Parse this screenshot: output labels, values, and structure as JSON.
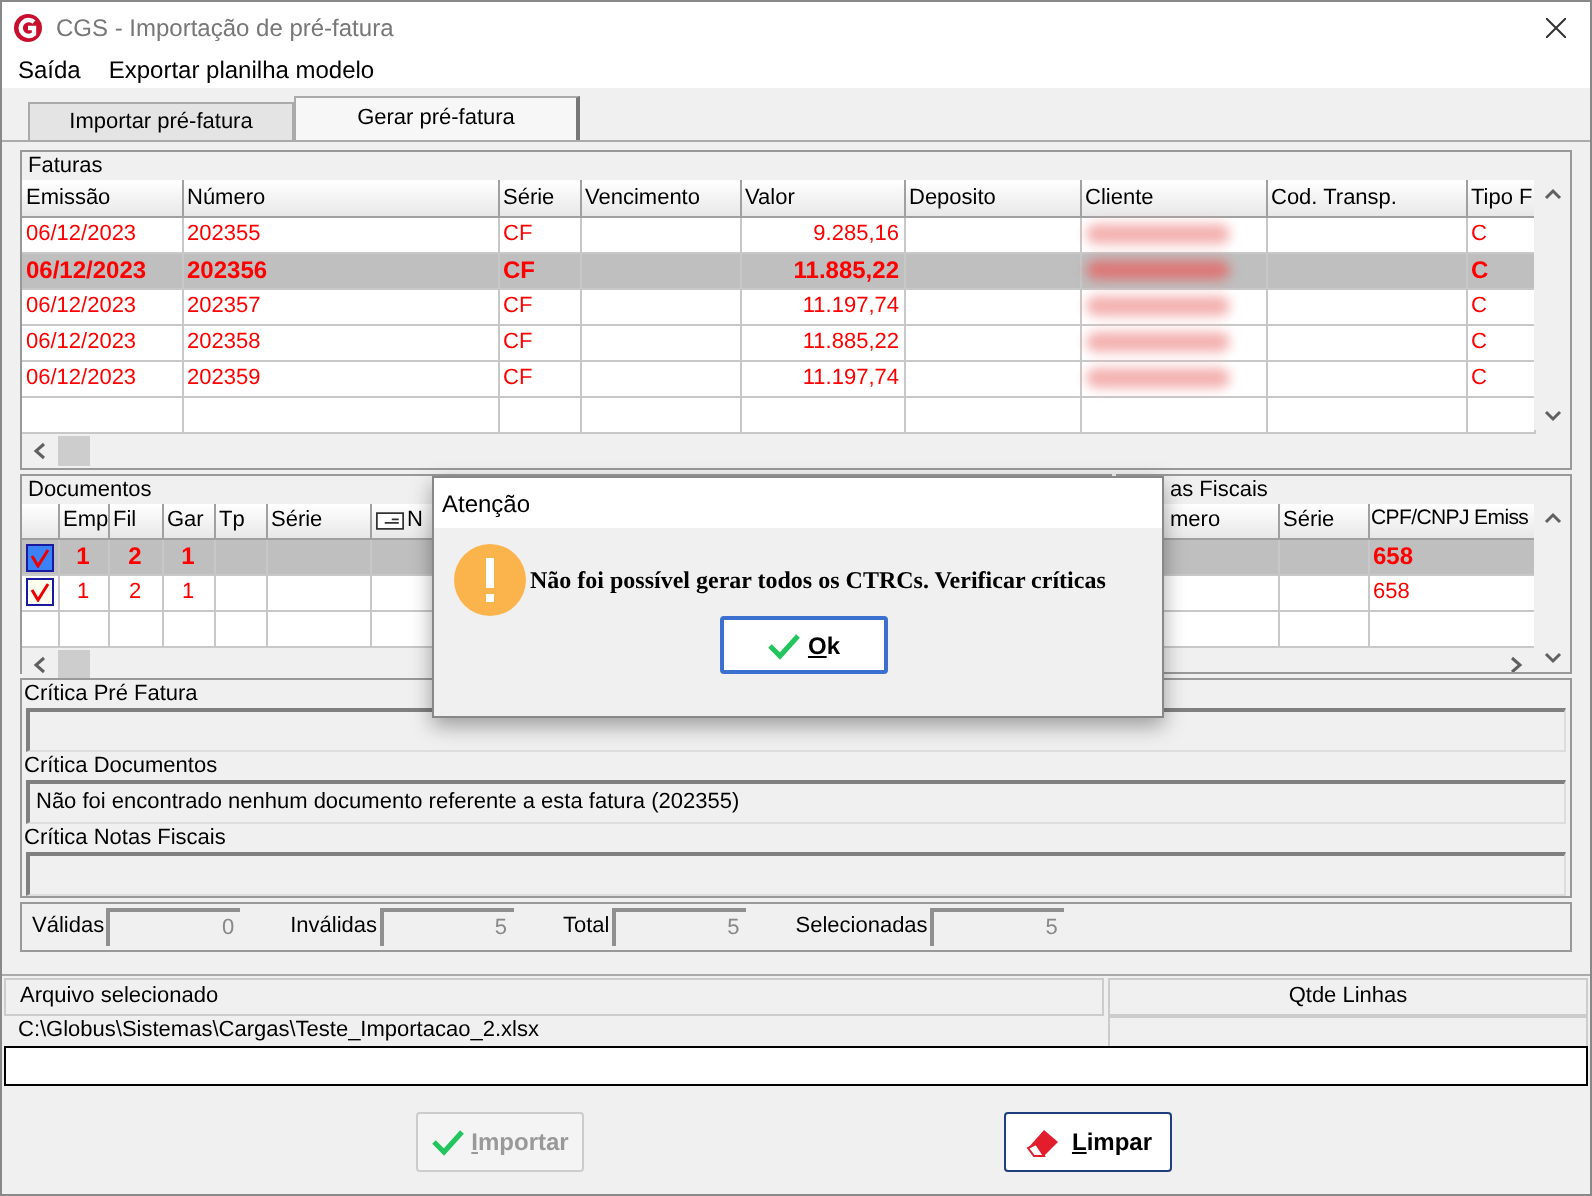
{
  "window": {
    "title": "CGS - Importação de pré-fatura"
  },
  "menu": [
    "Saída",
    "Exportar planilha modelo"
  ],
  "tabs": [
    {
      "label": "Importar pré-fatura",
      "selected": false
    },
    {
      "label": "Gerar pré-fatura",
      "selected": true
    }
  ],
  "faturas": {
    "title": "Faturas",
    "columns": [
      "Emissão",
      "Número",
      "Série",
      "Vencimento",
      "Valor",
      "Deposito",
      "Cliente",
      "Cod. Transp.",
      "Tipo F"
    ],
    "rows": [
      {
        "emissao": "06/12/2023",
        "numero": "202355",
        "serie": "CF",
        "valor": "9.285,16",
        "tipo": "C",
        "selected": false
      },
      {
        "emissao": "06/12/2023",
        "numero": "202356",
        "serie": "CF",
        "valor": "11.885,22",
        "tipo": "C",
        "selected": true
      },
      {
        "emissao": "06/12/2023",
        "numero": "202357",
        "serie": "CF",
        "valor": "11.197,74",
        "tipo": "C",
        "selected": false
      },
      {
        "emissao": "06/12/2023",
        "numero": "202358",
        "serie": "CF",
        "valor": "11.885,22",
        "tipo": "C",
        "selected": false
      },
      {
        "emissao": "06/12/2023",
        "numero": "202359",
        "serie": "CF",
        "valor": "11.197,74",
        "tipo": "C",
        "selected": false
      }
    ]
  },
  "documentos": {
    "title": "Documentos",
    "columns": [
      "Emp",
      "Fil",
      "Gar",
      "Tp",
      "Série",
      "N"
    ],
    "rows": [
      {
        "checked": true,
        "selected": true,
        "emp": "1",
        "fil": "2",
        "gar": "1"
      },
      {
        "checked": true,
        "selected": false,
        "emp": "1",
        "fil": "2",
        "gar": "1"
      }
    ]
  },
  "notas_fiscais": {
    "title": "as Fiscais",
    "columns": [
      "mero",
      "Série",
      "CPF/CNPJ Emiss"
    ],
    "rows": [
      {
        "cpf": "658",
        "selected": true
      },
      {
        "cpf": "658",
        "selected": false
      }
    ]
  },
  "criticas": [
    {
      "label": "Crítica Pré Fatura"
    },
    {
      "label": "Crítica Documentos",
      "text": "Não foi encontrado nenhum documento referente a esta fatura (202355)"
    },
    {
      "label": "Crítica Notas Fiscais"
    }
  ],
  "totals": [
    {
      "label": "Válidas",
      "value": "0"
    },
    {
      "label": "Inválidas",
      "value": "5"
    },
    {
      "label": "Total",
      "value": "5"
    },
    {
      "label": "Selecionadas",
      "value": "5"
    }
  ],
  "file": {
    "header": "Arquivo selecionado",
    "count_header": "Qtde Linhas",
    "path": "C:\\Globus\\Sistemas\\Cargas\\Teste_Importacao_2.xlsx"
  },
  "buttons": [
    {
      "label": "Importar",
      "kind": "import",
      "disabled": true
    },
    {
      "label": "Limpar",
      "kind": "clear",
      "disabled": false
    }
  ],
  "dialog": {
    "title": "Atenção",
    "message": "Não foi possível gerar todos os CTRCs. Verificar críticas",
    "button": "Ok"
  }
}
